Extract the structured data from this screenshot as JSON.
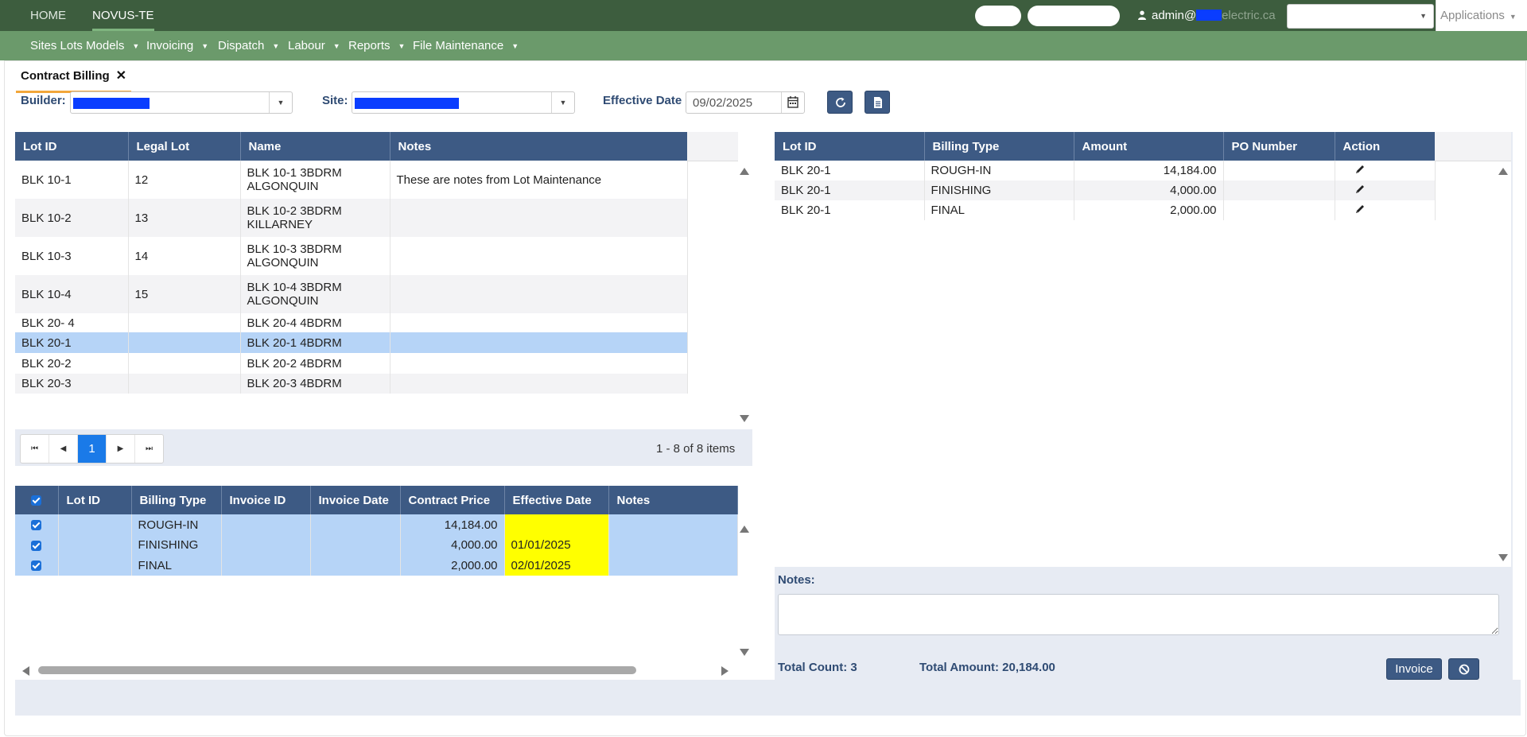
{
  "topbar": {
    "tabs": [
      {
        "label": "HOME"
      },
      {
        "label": "NOVUS-TE"
      }
    ],
    "user_name": "admin@",
    "user_domain": "electric.ca",
    "applications_label": "Applications"
  },
  "menu": [
    {
      "label": "Sites Lots Models"
    },
    {
      "label": "Invoicing"
    },
    {
      "label": "Dispatch"
    },
    {
      "label": "Labour"
    },
    {
      "label": "Reports"
    },
    {
      "label": "File Maintenance"
    }
  ],
  "page_tab": {
    "label": "Contract Billing",
    "close": "✕"
  },
  "filters": {
    "builder_label": "Builder:",
    "site_label": "Site:",
    "effective_date_label": "Effective Date",
    "effective_date_value": "09/02/2025"
  },
  "lots_grid": {
    "headers": [
      "Lot ID",
      "Legal Lot",
      "Name",
      "Notes"
    ],
    "rows": [
      {
        "lot_id": "BLK 10-1",
        "legal_lot": "12",
        "name1": "BLK 10-1 3BDRM",
        "name2": "ALGONQUIN",
        "notes": "These are notes from Lot Maintenance"
      },
      {
        "lot_id": "BLK 10-2",
        "legal_lot": "13",
        "name1": "BLK 10-2 3BDRM",
        "name2": "KILLARNEY",
        "notes": ""
      },
      {
        "lot_id": "BLK 10-3",
        "legal_lot": "14",
        "name1": "BLK 10-3 3BDRM",
        "name2": "ALGONQUIN",
        "notes": ""
      },
      {
        "lot_id": "BLK 10-4",
        "legal_lot": "15",
        "name1": "BLK 10-4 3BDRM",
        "name2": "ALGONQUIN",
        "notes": ""
      },
      {
        "lot_id": "BLK 20- 4",
        "legal_lot": "",
        "name1": "BLK 20-4 4BDRM",
        "name2": "",
        "notes": ""
      },
      {
        "lot_id": "BLK 20-1",
        "legal_lot": "",
        "name1": "BLK 20-1 4BDRM",
        "name2": "",
        "notes": ""
      },
      {
        "lot_id": "BLK 20-2",
        "legal_lot": "",
        "name1": "BLK 20-2 4BDRM",
        "name2": "",
        "notes": ""
      },
      {
        "lot_id": "BLK 20-3",
        "legal_lot": "",
        "name1": "BLK 20-3 4BDRM",
        "name2": "",
        "notes": ""
      }
    ],
    "selected_row": "BLK 20-1"
  },
  "pager": {
    "current_page": "1",
    "info": "1 - 8 of 8 items"
  },
  "billing_grid": {
    "headers": [
      "Lot ID",
      "Billing Type",
      "Invoice ID",
      "Invoice Date",
      "Contract Price",
      "Effective Date",
      "Notes"
    ],
    "rows": [
      {
        "lot_id": "",
        "billing_type": "ROUGH-IN",
        "invoice_id": "",
        "invoice_date": "",
        "contract_price": "14,184.00",
        "effective_date": "",
        "notes": ""
      },
      {
        "lot_id": "",
        "billing_type": "FINISHING",
        "invoice_id": "",
        "invoice_date": "",
        "contract_price": "4,000.00",
        "effective_date": "01/01/2025",
        "notes": ""
      },
      {
        "lot_id": "",
        "billing_type": "FINAL",
        "invoice_id": "",
        "invoice_date": "",
        "contract_price": "2,000.00",
        "effective_date": "02/01/2025",
        "notes": ""
      }
    ]
  },
  "invoice_grid": {
    "headers": [
      "Lot ID",
      "Billing Type",
      "Amount",
      "PO Number",
      "Action"
    ],
    "rows": [
      {
        "lot_id": "BLK 20-1",
        "billing_type": "ROUGH-IN",
        "amount": "14,184.00",
        "po_number": ""
      },
      {
        "lot_id": "BLK 20-1",
        "billing_type": "FINISHING",
        "amount": "4,000.00",
        "po_number": ""
      },
      {
        "lot_id": "BLK 20-1",
        "billing_type": "FINAL",
        "amount": "2,000.00",
        "po_number": ""
      }
    ]
  },
  "summary": {
    "notes_label": "Notes:",
    "total_count": "Total Count: 3",
    "total_amount": "Total Amount: 20,184.00",
    "invoice_button": "Invoice"
  },
  "colors": {
    "topbar": "#3d5d3e",
    "menubar": "#6b9a6b",
    "grid_header": "#3d5a84",
    "selected_row": "#b6d4f7",
    "highlight": "#ffff00"
  }
}
